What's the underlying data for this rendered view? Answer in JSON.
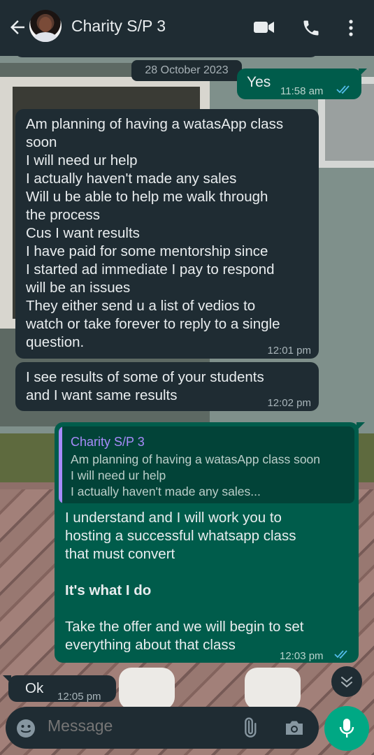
{
  "header": {
    "contact_name": "Charity S/P 3",
    "icons": [
      "back-arrow-icon",
      "video-call-icon",
      "phone-call-icon",
      "more-options-icon"
    ]
  },
  "chat": {
    "date_label": "28 October 2023",
    "messages": [
      {
        "direction": "outgoing",
        "lines": [
          "Yes"
        ],
        "time": "11:58 am",
        "status": "read"
      },
      {
        "direction": "incoming",
        "lines": [
          "Am planning of having a watasApp class",
          "soon",
          "I will need ur help",
          "I actually haven't made any sales",
          "Will u be able to help me walk through",
          "the process",
          "Cus I want results",
          "I have paid for some mentorship since",
          "I started ad immediate I pay to respond",
          "will be an issues",
          "They either send u a list of vedios to",
          "watch or take forever to reply to a single",
          "question."
        ],
        "time": "12:01 pm"
      },
      {
        "direction": "incoming",
        "lines": [
          "I see results of some of your students",
          "and I want same results"
        ],
        "time": "12:02 pm"
      },
      {
        "direction": "outgoing",
        "quote": {
          "author": "Charity S/P 3",
          "lines": [
            "Am planning of having a watasApp class soon",
            "I will need ur help",
            "I actually haven't made any sales..."
          ]
        },
        "lines": [
          "I understand and I will work you to",
          "hosting a successful whatsapp class",
          "that must convert",
          "",
          "It's what I do",
          "",
          "Take the offer and we will begin to set",
          "everything about that class"
        ],
        "time": "12:03 pm",
        "status": "read"
      },
      {
        "direction": "incoming",
        "lines": [
          "Ok"
        ],
        "time": "12:05 pm"
      }
    ]
  },
  "composer": {
    "placeholder": "Message",
    "icons": [
      "emoji-icon",
      "attach-icon",
      "camera-icon",
      "mic-icon"
    ]
  },
  "colors": {
    "header_bg": "#1f2c33",
    "incoming_bubble": "#1f2c33",
    "outgoing_bubble": "#005c4b",
    "accent": "#00a884",
    "read_ticks": "#53bdeb",
    "quote_author": "#a78bfa"
  }
}
